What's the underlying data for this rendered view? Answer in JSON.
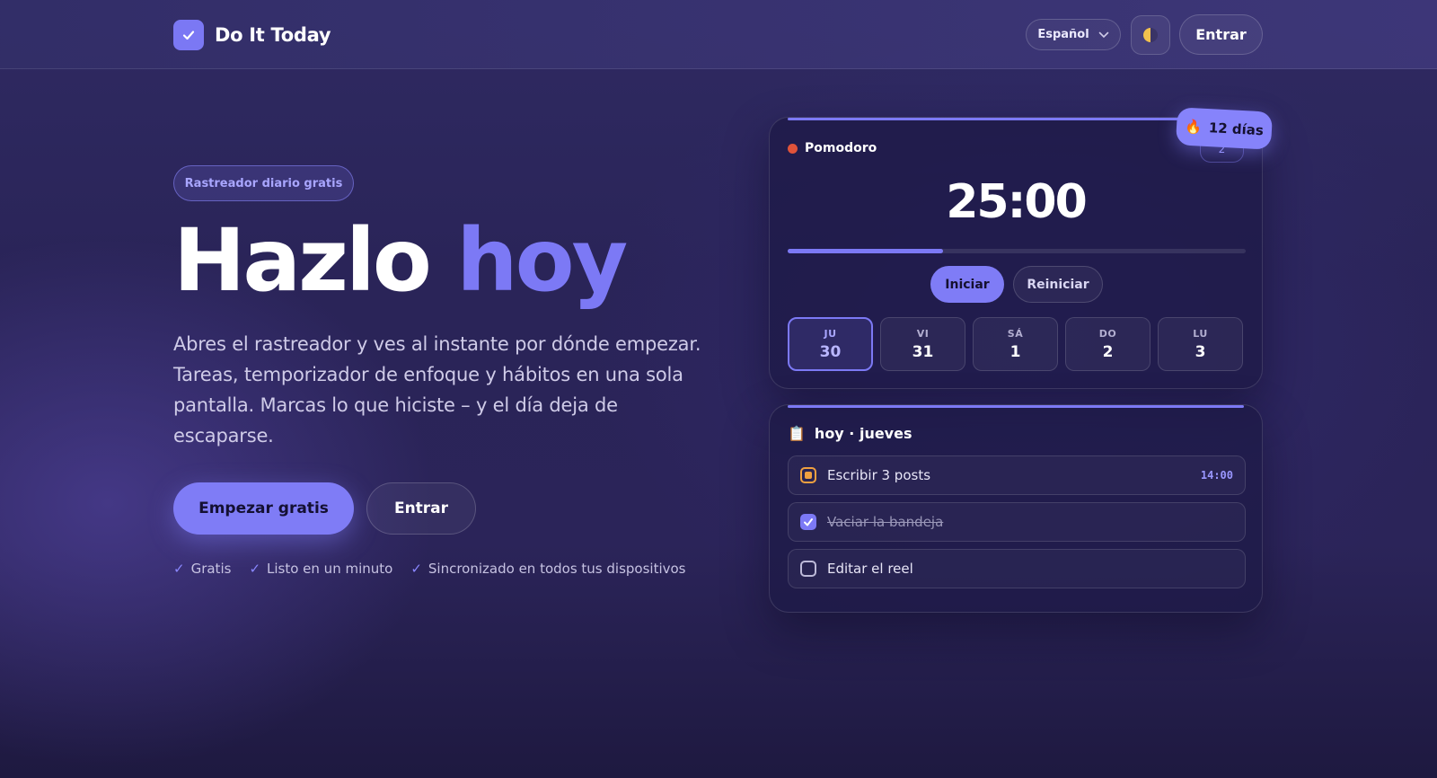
{
  "header": {
    "app_name": "Do It Today",
    "language": "Español",
    "login_label": "Entrar"
  },
  "hero": {
    "badge": "Rastreador diario gratis",
    "title_part1": "Hazlo",
    "title_part2": "hoy",
    "description": "Abres el rastreador y ves al instante por dónde empezar. Tareas, temporizador de enfoque y hábitos en una sola pantalla. Marcas lo que hiciste – y el día deja de escaparse.",
    "cta_primary": "Empezar gratis",
    "cta_secondary": "Entrar",
    "perks": [
      "Gratis",
      "Listo en un minuto",
      "Sincronizado en todos tus dispositivos"
    ]
  },
  "pomodoro": {
    "label": "Pomodoro",
    "count": "2",
    "streak": "12 días",
    "timer": "25:00",
    "progress": 0.34,
    "start_label": "Iniciar",
    "reset_label": "Reiniciar",
    "days": [
      {
        "name": "JU",
        "date": "30",
        "active": true
      },
      {
        "name": "VI",
        "date": "31",
        "active": false
      },
      {
        "name": "SÁ",
        "date": "1",
        "active": false
      },
      {
        "name": "DO",
        "date": "2",
        "active": false
      },
      {
        "name": "LU",
        "date": "3",
        "active": false
      }
    ]
  },
  "tasks": {
    "title": "hoy · jueves",
    "items": [
      {
        "label": "Escribir 3 posts",
        "time": "14:00",
        "state": "in-progress"
      },
      {
        "label": "Vaciar la bandeja",
        "time": "",
        "state": "done"
      },
      {
        "label": "Editar el reel",
        "time": "",
        "state": "todo"
      }
    ]
  },
  "colors": {
    "accent": "#7c79f5",
    "background": "#2b2459",
    "in_progress": "#f0a040"
  }
}
